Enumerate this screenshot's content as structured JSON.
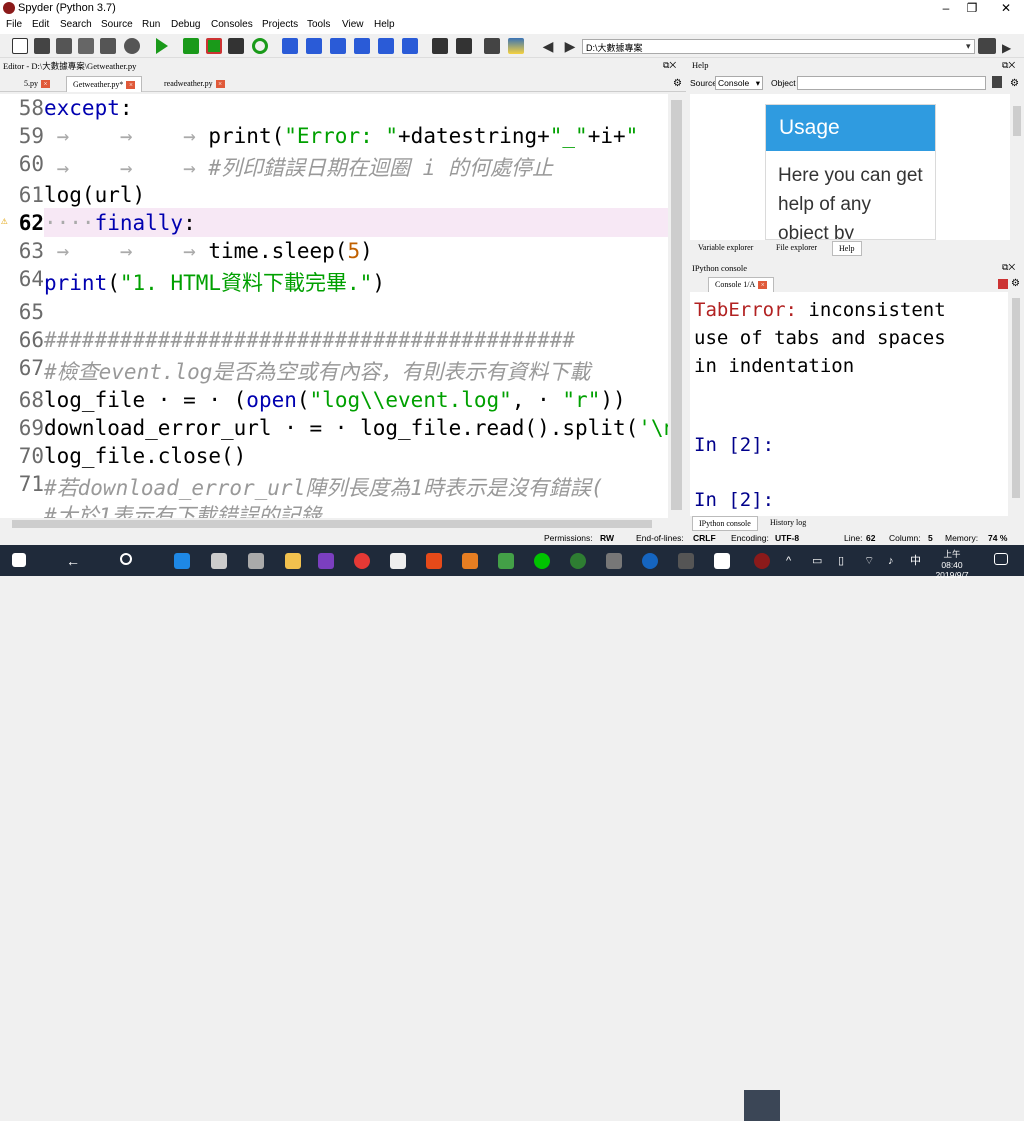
{
  "window": {
    "title": "Spyder (Python 3.7)",
    "minimize": "–",
    "maximize": "❐",
    "close": "✕"
  },
  "menu": [
    "File",
    "Edit",
    "Search",
    "Source",
    "Run",
    "Debug",
    "Consoles",
    "Projects",
    "Tools",
    "View",
    "Help"
  ],
  "toolbar": {
    "path": "D:\\大數據專案"
  },
  "editor": {
    "panel_title": "Editor - D:\\大數據專案\\Getweather.py",
    "tabs": [
      {
        "label": "5.py"
      },
      {
        "label": "Getweather.py*"
      },
      {
        "label": "readweather.py"
      }
    ],
    "warning_mark": "⚠"
  },
  "help": {
    "panel_title": "Help",
    "source_label": "Source",
    "source_value": "Console",
    "object_label": "Object",
    "usage_title": "Usage",
    "usage_text": "Here you can get help of any object by",
    "tabs": [
      "Variable explorer",
      "File explorer",
      "Help"
    ]
  },
  "ipython": {
    "panel_title": "IPython console",
    "tab": "Console 1/A",
    "error_type": "TabError:",
    "error_msg1": " inconsistent",
    "error_msg2": "use of tabs and spaces",
    "error_msg3": "in indentation",
    "prompt1": "In [2]:",
    "prompt2": "In [2]:",
    "bottom_tabs": [
      "IPython console",
      "History log"
    ]
  },
  "status": {
    "permissions_label": "Permissions:",
    "permissions": "RW",
    "eol_label": "End-of-lines:",
    "eol": "CRLF",
    "encoding_label": "Encoding:",
    "encoding": "UTF-8",
    "line_label": "Line:",
    "line": "62",
    "column_label": "Column:",
    "column": "5",
    "memory_label": "Memory:",
    "memory": "74 %"
  },
  "taskbar": {
    "time": "上午 08:40",
    "date": "2019/9/7"
  }
}
